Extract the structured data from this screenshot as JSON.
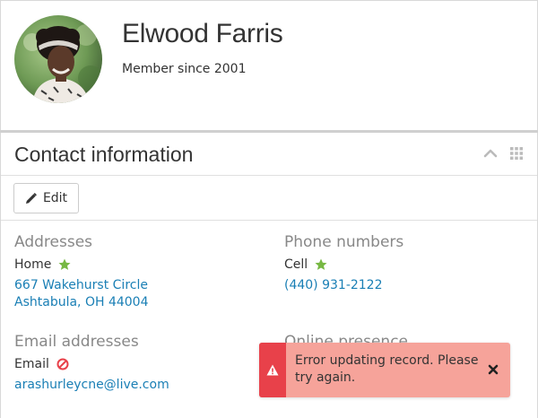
{
  "profile": {
    "name": "Elwood Farris",
    "member_since": "Member since 2001",
    "avatar_icon": "avatar-photo"
  },
  "contact": {
    "title": "Contact information",
    "collapse_icon": "chevron-up-icon",
    "grid_icon": "grid-icon",
    "edit_label": "Edit",
    "addresses": {
      "title": "Addresses",
      "type": "Home",
      "primary": true,
      "line1": "667 Wakehurst Circle",
      "line2": "Ashtabula, OH 44004"
    },
    "phones": {
      "title": "Phone numbers",
      "type": "Cell",
      "primary": true,
      "number": "(440) 931-2122"
    },
    "emails": {
      "title": "Email addresses",
      "type": "Email",
      "status": "do-not-contact",
      "address": "arashurleycne@live.com"
    },
    "online": {
      "title": "Online presence"
    }
  },
  "toast": {
    "message": "Error updating record. Please try again.",
    "type": "error"
  },
  "colors": {
    "link": "#1a7fb5",
    "star": "#77b843",
    "ban": "#e8414a",
    "toast_bg": "#f6a39a",
    "toast_bar": "#e8414a"
  }
}
